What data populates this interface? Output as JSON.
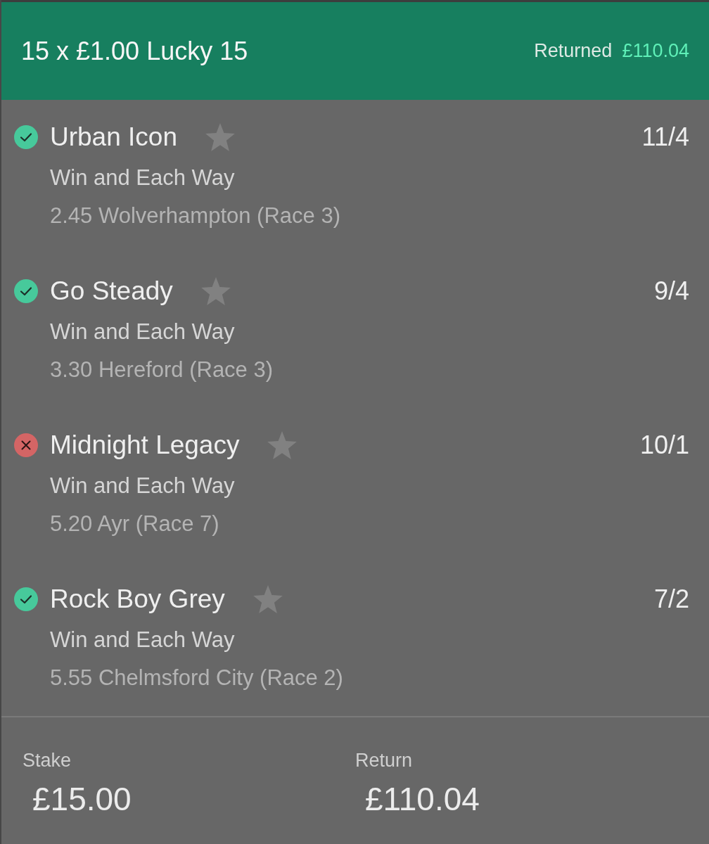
{
  "bet": {
    "title": "15 x £1.00 Lucky 15",
    "returned_label": "Returned",
    "returned_value": "£110.04"
  },
  "selections": [
    {
      "won": true,
      "name": "Urban Icon",
      "odds": "11/4",
      "market": "Win and Each Way",
      "event": "2.45 Wolverhampton (Race 3)"
    },
    {
      "won": true,
      "name": "Go Steady",
      "odds": "9/4",
      "market": "Win and Each Way",
      "event": "3.30 Hereford (Race 3)"
    },
    {
      "won": false,
      "name": "Midnight Legacy",
      "odds": "10/1",
      "market": "Win and Each Way",
      "event": "5.20 Ayr (Race 7)"
    },
    {
      "won": true,
      "name": "Rock Boy Grey",
      "odds": "7/2",
      "market": "Win and Each Way",
      "event": "5.55 Chelmsford City (Race 2)"
    }
  ],
  "summary": [
    {
      "label": "Stake",
      "value": "£15.00"
    },
    {
      "label": "Return",
      "value": "£110.04"
    }
  ]
}
